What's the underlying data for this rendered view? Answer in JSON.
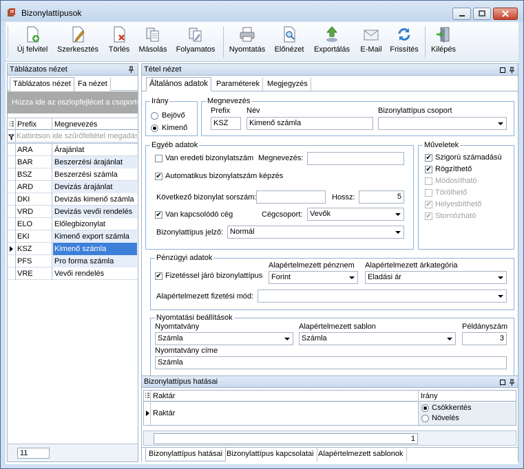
{
  "window": {
    "title": "Bizonylattípusok"
  },
  "toolbar": {
    "new": "Új felvitel",
    "edit": "Szerkesztés",
    "delete": "Törlés",
    "copy": "Másolás",
    "continuous": "Folyamatos",
    "print": "Nyomtatás",
    "preview": "Előnézet",
    "export": "Exportálás",
    "email": "E-Mail",
    "refresh": "Frissítés",
    "exit": "Kilépés"
  },
  "left": {
    "title": "Táblázatos nézet",
    "tabs": [
      "Táblázatos nézet",
      "Fa nézet"
    ],
    "group_hint": "Húzza ide az oszlopfejlécet a csoportosításhoz",
    "columns": [
      "Prefix",
      "Megnevezés"
    ],
    "filter_hint": "Kattintson ide szűrőfeltétel megadásához",
    "rows": [
      {
        "prefix": "ARA",
        "name": "Árajánlat"
      },
      {
        "prefix": "BAR",
        "name": "Beszerzési árajánlat"
      },
      {
        "prefix": "BSZ",
        "name": "Beszerzési számla"
      },
      {
        "prefix": "ARD",
        "name": "Devizás árajánlat"
      },
      {
        "prefix": "DKI",
        "name": "Devizás kimenő számla"
      },
      {
        "prefix": "VRD",
        "name": "Devizás vevői rendelés"
      },
      {
        "prefix": "ELO",
        "name": "Előlegbizonylat"
      },
      {
        "prefix": "EKI",
        "name": "Kimenő export számla"
      },
      {
        "prefix": "KSZ",
        "name": "Kimenő számla"
      },
      {
        "prefix": "PFS",
        "name": "Pro forma számla"
      },
      {
        "prefix": "VRE",
        "name": "Vevői rendelés"
      }
    ],
    "selected_index": 8,
    "count": "11"
  },
  "detail": {
    "title": "Tétel nézet",
    "tabs": [
      "Általános adatok",
      "Paraméterek",
      "Megjegyzés"
    ],
    "irany": {
      "legend": "Irány",
      "in": "Bejövő",
      "out": "Kimenő"
    },
    "megnevezes": {
      "legend": "Megnevezés",
      "prefix_label": "Prefix",
      "prefix": "KSZ",
      "name_label": "Név",
      "name": "Kimenő számla",
      "group_label": "Bizonylattípus csoport",
      "group": ""
    },
    "egyeb": {
      "legend": "Egyéb adatok",
      "orig_number": "Van eredeti bizonylatszám",
      "orig_name_label": "Megnevezés:",
      "orig_name": "",
      "auto_number": "Automatikus bizonylatszám képzés",
      "next_label": "Következő bizonylat sorszám:",
      "next": "",
      "length_label": "Hossz:",
      "length": "5",
      "linked": "Van kapcsolódó cég",
      "company_group_label": "Cégcsoport:",
      "company_group": "Vevők",
      "marker_label": "Bizonylattípus jelző:",
      "marker": "Normál"
    },
    "muveletek": {
      "legend": "Műveletek",
      "items": [
        "Szigorú számadású",
        "Rögzíthető",
        "Módosítható",
        "Törölhető",
        "Helyesbíthető",
        "Stornózható"
      ]
    },
    "penzugy": {
      "legend": "Pénzügyi adatok",
      "payment": "Fizetéssel járó bizonylattípus",
      "currency_label": "Alapértelmezett pénznem",
      "currency": "Forint",
      "price_cat_label": "Alapértelmezett árkategória",
      "price_cat": "Eladási ár",
      "pay_mode_label": "Alapértelmezett fizetési mód:",
      "pay_mode": ""
    },
    "nyomtatas": {
      "legend": "Nyomtatási beállítások",
      "form_label": "Nyomtatvány",
      "form": "Számla",
      "template_label": "Alapértelmezett sablon",
      "template": "Számla",
      "copies_label": "Példányszám",
      "copies": "3",
      "form_title_label": "Nyomtatvány címe",
      "form_title": "Számla"
    }
  },
  "bottom": {
    "title": "Bizonylattípus hatásai",
    "columns": [
      "Raktár",
      "Irány"
    ],
    "row": {
      "name": "Raktár",
      "dec": "Csökkentés",
      "inc": "Növelés"
    },
    "count": "1",
    "tabs": [
      "Bizonylattípus hatásai",
      "Bizonylattípus kapcsolatai",
      "Alapértelmezett sablonok"
    ]
  }
}
